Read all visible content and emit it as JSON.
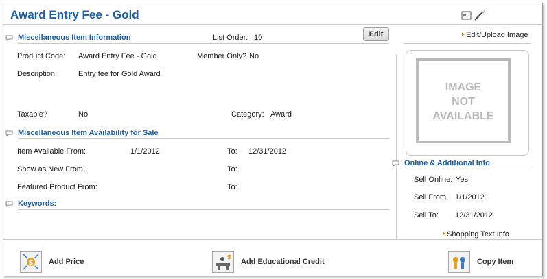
{
  "page": {
    "title": "Award Entry Fee - Gold"
  },
  "misc": {
    "section_title": "Miscellaneous Item Information",
    "list_order_label": "List Order:",
    "list_order_value": "10",
    "edit_label": "Edit",
    "product_code_label": "Product Code:",
    "product_code_value": "Award Entry Fee - Gold",
    "member_only_label": "Member Only?",
    "member_only_value": "No",
    "description_label": "Description:",
    "description_value": "Entry fee for Gold Award",
    "taxable_label": "Taxable?",
    "taxable_value": "No",
    "category_label": "Category:",
    "category_value": "Award"
  },
  "availability": {
    "section_title": "Miscellaneous Item Availability for Sale",
    "item_available_label": "Item Available From:",
    "item_available_from": "1/1/2012",
    "to_label": "To:",
    "item_available_to": "12/31/2012",
    "show_new_label": "Show as New From:",
    "featured_label": "Featured Product From:"
  },
  "keywords": {
    "section_title": "Keywords:"
  },
  "image": {
    "edit_upload_label": "Edit/Upload Image",
    "placeholder_lines": [
      "IMAGE",
      "NOT",
      "AVAILABLE"
    ]
  },
  "online": {
    "section_title": "Online & Additional Info",
    "sell_online_label": "Sell Online:",
    "sell_online_value": "Yes",
    "sell_from_label": "Sell From:",
    "sell_from_value": "1/1/2012",
    "sell_to_label": "Sell To:",
    "sell_to_value": "12/31/2012",
    "shopping_text_label": "Shopping Text Info"
  },
  "footer": {
    "add_price_label": "Add Price",
    "add_credit_label": "Add Educational Credit",
    "copy_item_label": "Copy Item"
  },
  "colors": {
    "accent": "#1a5fa8",
    "link_arrow": "#e08a00"
  }
}
